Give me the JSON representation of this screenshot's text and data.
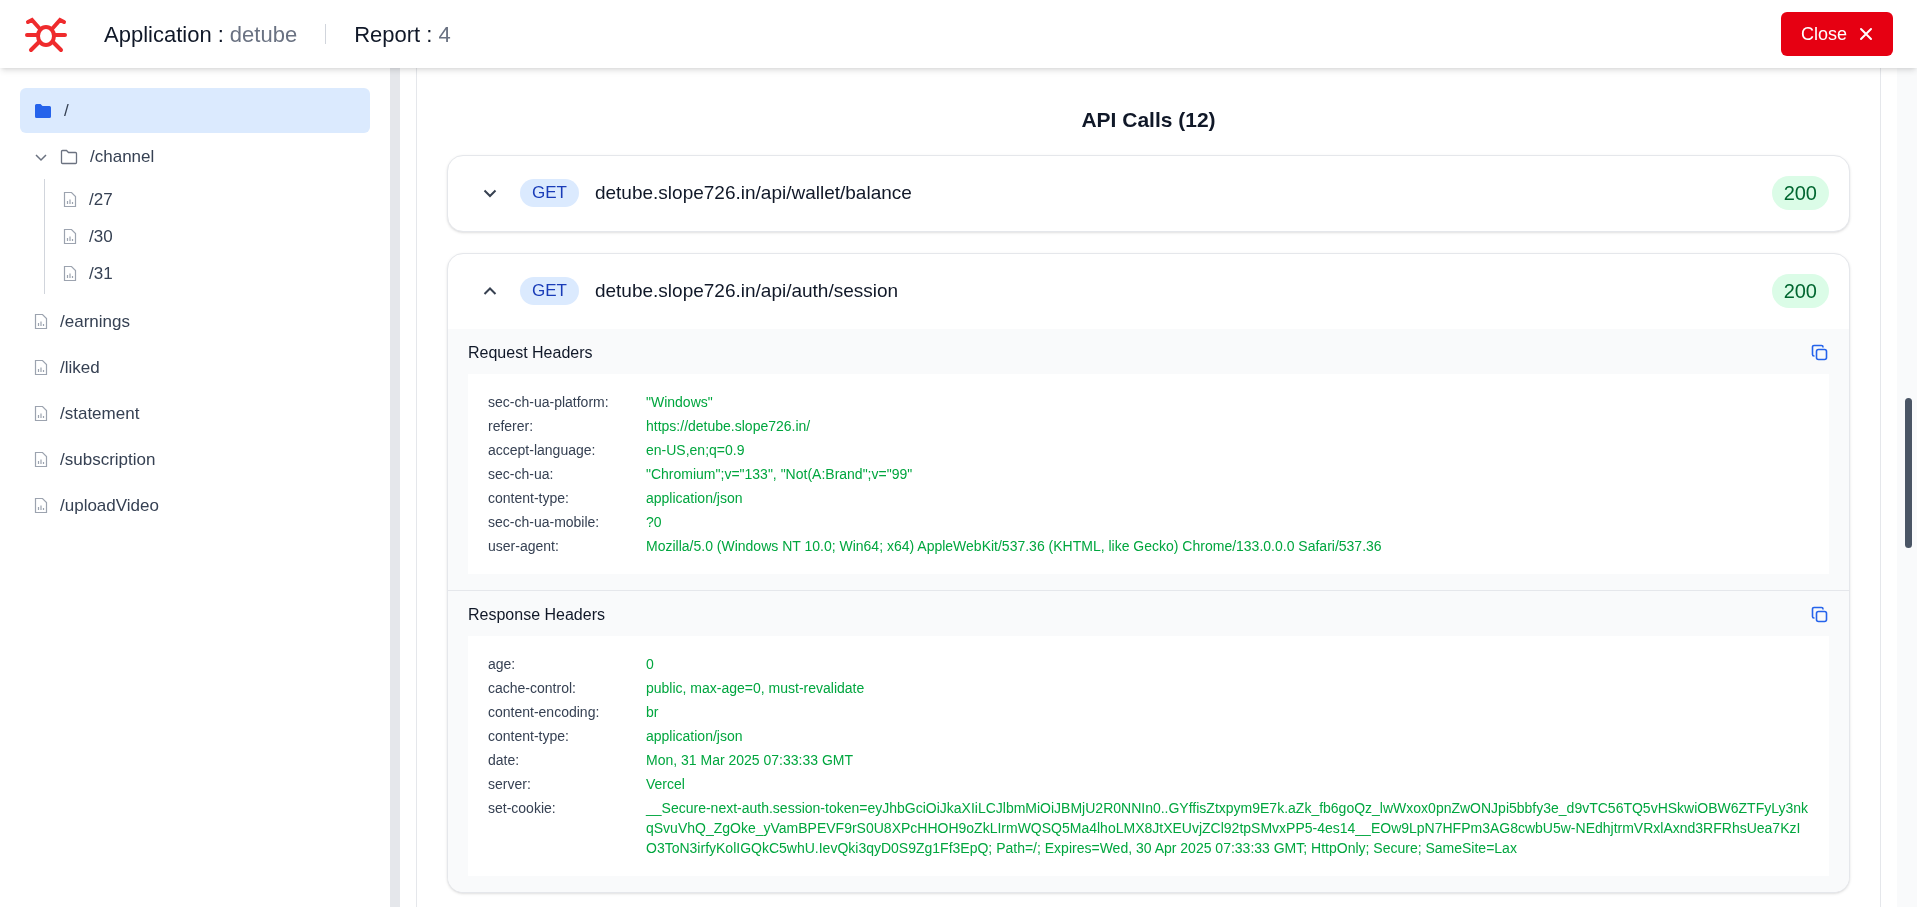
{
  "header": {
    "application_label": "Application :",
    "application_name": "detube",
    "report_label": "Report :",
    "report_number": "4",
    "close_button": "Close"
  },
  "sidebar": {
    "items": [
      {
        "kind": "folder",
        "label": "/",
        "selected": true
      },
      {
        "kind": "folder",
        "label": "/channel",
        "selected": false,
        "expanded": true,
        "children": [
          {
            "kind": "file",
            "label": "/27",
            "selected": false
          },
          {
            "kind": "file",
            "label": "/30",
            "selected": false
          },
          {
            "kind": "file",
            "label": "/31",
            "selected": false
          }
        ]
      },
      {
        "kind": "file",
        "label": "/earnings",
        "selected": false
      },
      {
        "kind": "file",
        "label": "/liked",
        "selected": false
      },
      {
        "kind": "file",
        "label": "/statement",
        "selected": false
      },
      {
        "kind": "file",
        "label": "/subscription",
        "selected": false
      },
      {
        "kind": "file",
        "label": "/uploadVideo",
        "selected": false
      }
    ]
  },
  "main": {
    "title": "API Calls (12)",
    "calls": [
      {
        "method": "GET",
        "url": "detube.slope726.in/api/wallet/balance",
        "status": "200",
        "expanded": false
      },
      {
        "method": "GET",
        "url": "detube.slope726.in/api/auth/session",
        "status": "200",
        "expanded": true,
        "sections": [
          {
            "title": "Request Headers",
            "headers": [
              {
                "name": "sec-ch-ua-platform:",
                "value": "\"Windows\""
              },
              {
                "name": "referer:",
                "value": "https://detube.slope726.in/"
              },
              {
                "name": "accept-language:",
                "value": "en-US,en;q=0.9"
              },
              {
                "name": "sec-ch-ua:",
                "value": "\"Chromium\";v=\"133\", \"Not(A:Brand\";v=\"99\""
              },
              {
                "name": "content-type:",
                "value": "application/json"
              },
              {
                "name": "sec-ch-ua-mobile:",
                "value": "?0"
              },
              {
                "name": "user-agent:",
                "value": "Mozilla/5.0 (Windows NT 10.0; Win64; x64) AppleWebKit/537.36 (KHTML, like Gecko) Chrome/133.0.0.0 Safari/537.36"
              }
            ]
          },
          {
            "title": "Response Headers",
            "headers": [
              {
                "name": "age:",
                "value": "0"
              },
              {
                "name": "cache-control:",
                "value": "public, max-age=0, must-revalidate"
              },
              {
                "name": "content-encoding:",
                "value": "br"
              },
              {
                "name": "content-type:",
                "value": "application/json"
              },
              {
                "name": "date:",
                "value": "Mon, 31 Mar 2025 07:33:33 GMT"
              },
              {
                "name": "server:",
                "value": "Vercel"
              },
              {
                "name": "set-cookie:",
                "value": "__Secure-next-auth.session-token=eyJhbGciOiJkaXIiLCJlbmMiOiJBMjU2R0NNIn0..GYffisZtxpym9E7k.aZk_fb6goQz_lwWxox0pnZwONJpi5bbfy3e_d9vTC56TQ5vHSkwiOBW6ZTFyLy3nkqSvuVhQ_ZgOke_yVamBPEVF9rS0U8XPcHHOH9oZkLIrmWQSQ5Ma4lhoLMX8JtXEUvjZCl92tpSMvxPP5-4es14__EOw9LpN7HFPm3AG8cwbU5w-NEdhjtrmVRxlAxnd3RFRhsUea7KzIO3ToN3irfyKolIGQkC5whU.IevQki3qyD0S9Zg1Ff3EpQ; Path=/; Expires=Wed, 30 Apr 2025 07:33:33 GMT; HttpOnly; Secure; SameSite=Lax"
              }
            ]
          }
        ]
      }
    ]
  }
}
